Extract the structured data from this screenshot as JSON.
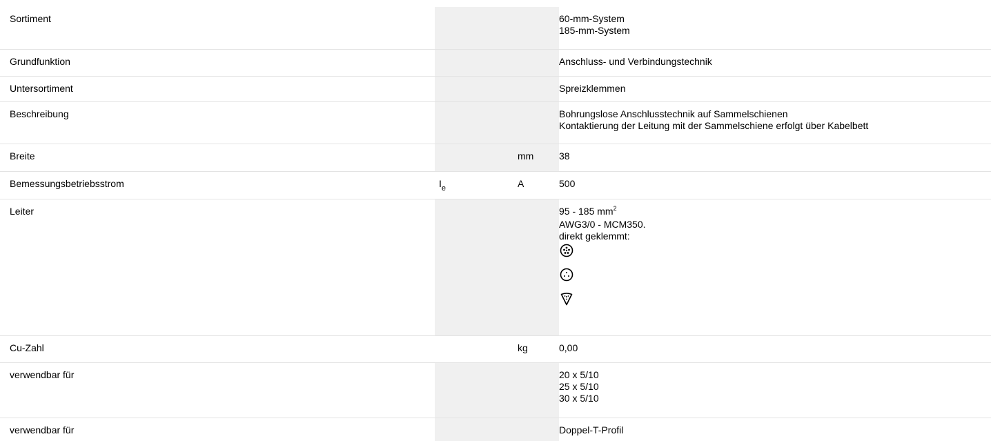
{
  "header": {
    "title": ""
  },
  "rows": [
    {
      "label": "Sortiment",
      "symbol": "",
      "unit": "",
      "values": [
        "60-mm-System",
        "185-mm-System"
      ]
    },
    {
      "label": "Grundfunktion",
      "symbol": "",
      "unit": "",
      "values": [
        "Anschluss- und Verbindungstechnik"
      ]
    },
    {
      "label": "Untersortiment",
      "symbol": "",
      "unit": "",
      "values": [
        "Spreizklemmen"
      ]
    },
    {
      "label": "Beschreibung",
      "symbol": "",
      "unit": "",
      "values": [
        "Bohrungslose Anschlusstechnik auf Sammelschienen",
        "Kontaktierung der Leitung mit der Sammelschiene erfolgt über Kabelbett"
      ]
    },
    {
      "label": "Breite",
      "symbol": "",
      "unit": "mm",
      "values": [
        "38"
      ]
    },
    {
      "label": "Bemessungsbetriebsstrom",
      "symbol_main": "I",
      "symbol_sub": "e",
      "unit": "A",
      "values": [
        "500"
      ]
    },
    {
      "label": "Leiter",
      "symbol": "",
      "unit": "",
      "value_main": "95 - 185 mm",
      "value_sup": "2",
      "values": [
        "AWG3/0 - MCM350.",
        "direkt geklemmt:"
      ],
      "icons": [
        "stranded-conductor-icon",
        "fine-stranded-conductor-icon",
        "sector-conductor-icon"
      ]
    },
    {
      "label": "Cu-Zahl",
      "symbol": "",
      "unit": "kg",
      "values": [
        "0,00"
      ]
    },
    {
      "label": "verwendbar für",
      "symbol": "",
      "unit": "",
      "values": [
        "20 x 5/10",
        "25 x 5/10",
        "30 x 5/10"
      ]
    },
    {
      "label": "verwendbar für",
      "symbol": "",
      "unit": "",
      "values": [
        "Doppel-T-Profil"
      ]
    }
  ],
  "colors": {
    "shaded_column": "#f0f0f0",
    "row_divider": "#e3e3e3",
    "header_blue": "#0a4fa3"
  }
}
